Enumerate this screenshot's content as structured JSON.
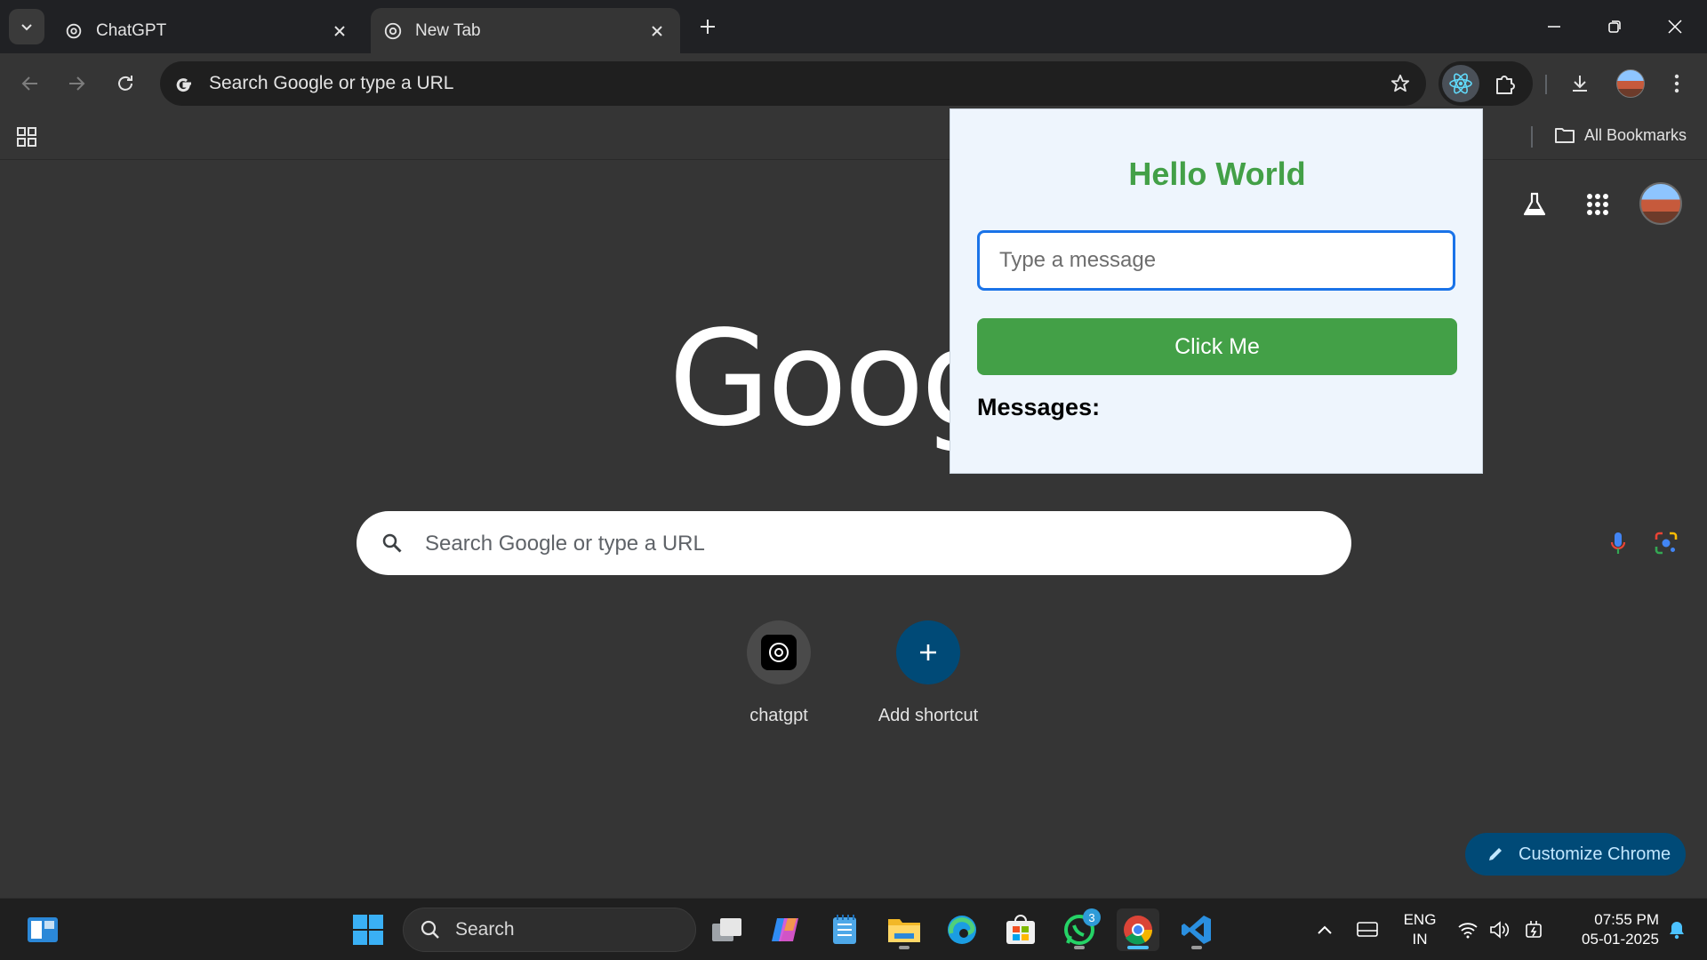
{
  "browser": {
    "tabs": [
      {
        "title": "ChatGPT",
        "active": false
      },
      {
        "title": "New Tab",
        "active": true
      }
    ],
    "omnibox": {
      "text": "Search Google or type a URL"
    },
    "bookmarks": {
      "all_bookmarks_label": "All Bookmarks"
    }
  },
  "ntp": {
    "logo_text": "Goog",
    "search_placeholder": "Search Google or type a URL",
    "shortcuts": [
      {
        "label": "chatgpt"
      },
      {
        "label": "Add shortcut"
      }
    ],
    "customize_label": "Customize Chrome"
  },
  "popup": {
    "title": "Hello World",
    "input_placeholder": "Type a message",
    "input_value": "",
    "button_label": "Click Me",
    "messages_label": "Messages:",
    "colors": {
      "accent": "#43a047",
      "background": "#eef5fd",
      "focus": "#1a73e8"
    }
  },
  "taskbar": {
    "search_label": "Search",
    "whatsapp_badge": "3",
    "language": {
      "line1": "ENG",
      "line2": "IN"
    },
    "clock": {
      "time": "07:55 PM",
      "date": "05-01-2025"
    }
  }
}
